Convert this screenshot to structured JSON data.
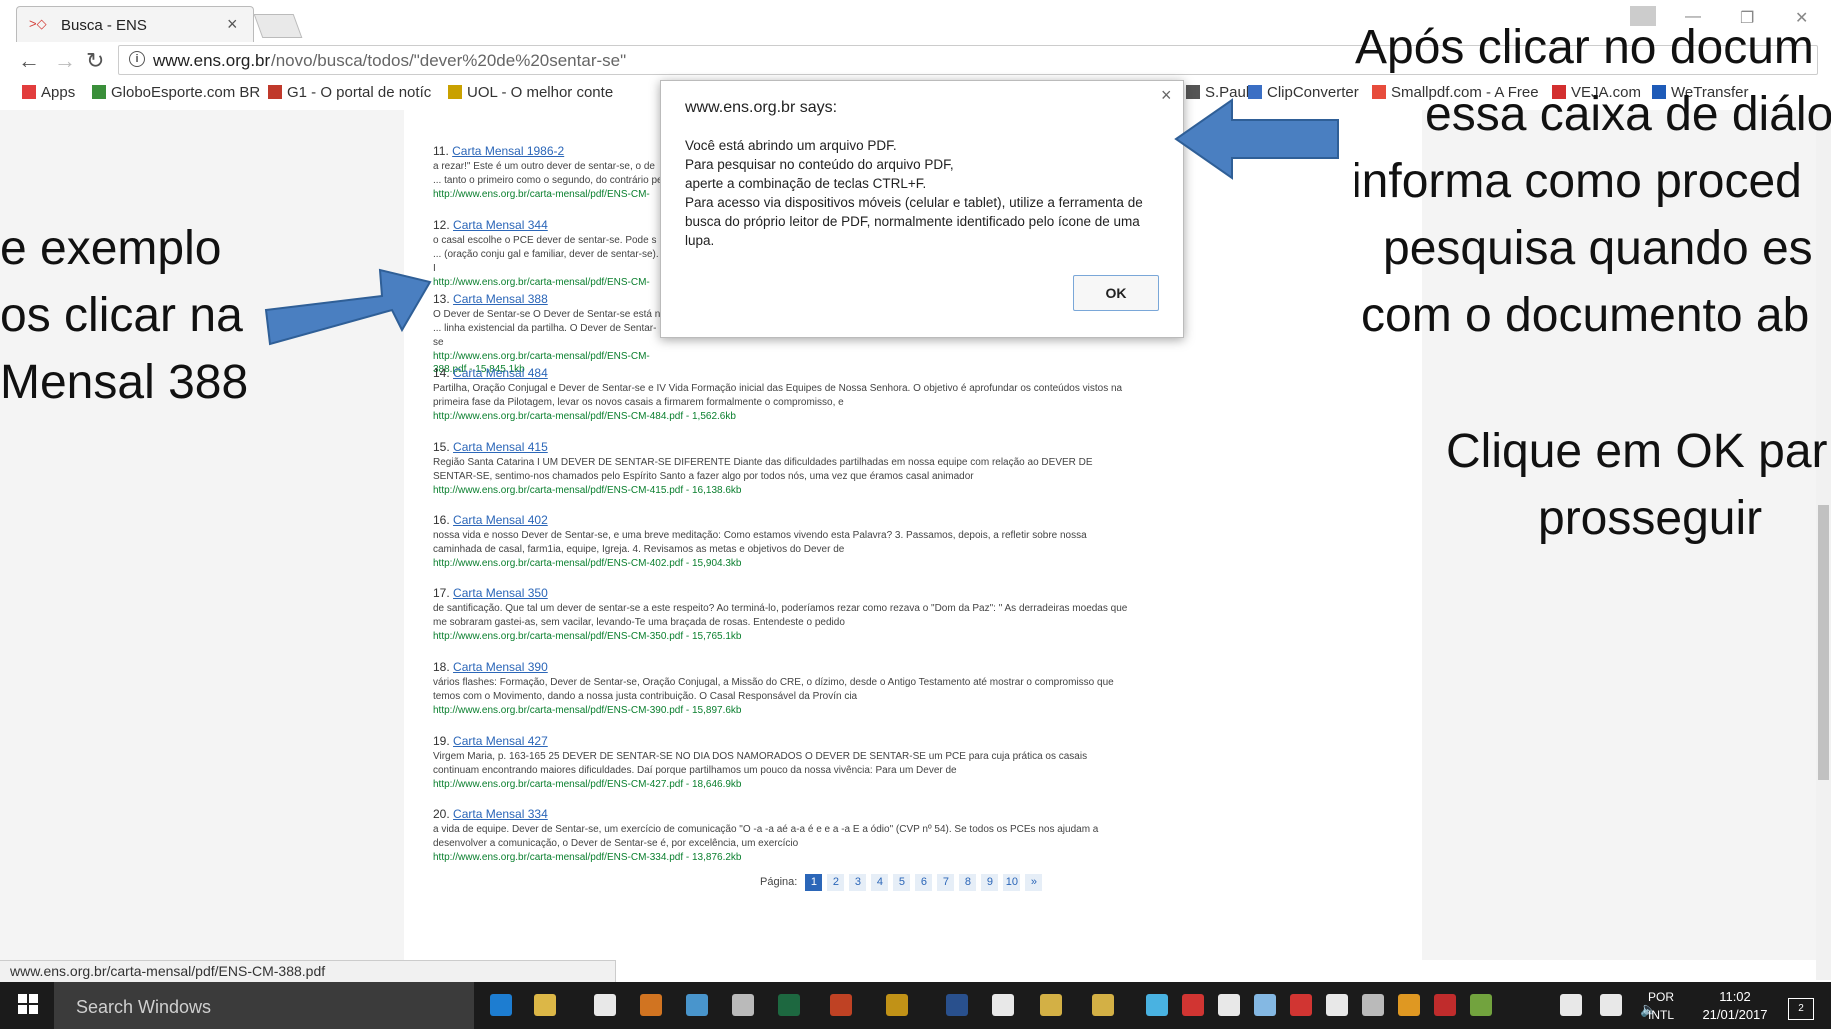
{
  "browser": {
    "tab_title": "Busca - ENS",
    "tab_favicon": "ens-favicon",
    "url_host": "www.ens.org.br",
    "url_path": "/novo/busca/todos/\"dever%20de%20sentar-se\"",
    "bookmarks": [
      {
        "label": "Apps",
        "color": "#e23d3d"
      },
      {
        "label": "GloboEsporte.com BR",
        "color": "#3a8f3a"
      },
      {
        "label": "G1 - O portal de notíc",
        "color": "#c0392b"
      },
      {
        "label": "UOL - O melhor conte",
        "color": "#c9a100"
      },
      {
        "label": "S.Paulo",
        "color": "#555555"
      },
      {
        "label": "ClipConverter",
        "color": "#3b6fc4"
      },
      {
        "label": "Smallpdf.com - A Free",
        "color": "#e74c3c"
      },
      {
        "label": "VEJA.com",
        "color": "#d32f2f"
      },
      {
        "label": "WeTransfer",
        "color": "#1e5bb8"
      }
    ]
  },
  "results": [
    {
      "num": "11.",
      "title": "Carta Mensal 1986-2",
      "snippet": "a rezar!\" Este é um outro dever de sentar-se, o de ... tanto o primeiro como o segundo, do contrário pe",
      "url": "http://www.ens.org.br/carta-mensal/pdf/ENS-CM-"
    },
    {
      "num": "12.",
      "title": "Carta Mensal 344",
      "snippet": "o casal escolhe o PCE dever de sentar-se. Pode s ... (oração conju gal e familiar, dever de sentar-se). I",
      "url": "http://www.ens.org.br/carta-mensal/pdf/ENS-CM-"
    },
    {
      "num": "13.",
      "title": "Carta Mensal 388",
      "snippet": "O Dever de Sentar-se O Dever de Sentar-se está n ... linha existencial da partilha. O Dever de Sentar-se",
      "url": "http://www.ens.org.br/carta-mensal/pdf/ENS-CM-388.pdf - 15,845.1kb"
    },
    {
      "num": "14.",
      "title": "Carta Mensal 484",
      "snippet": "Partilha, Oração Conjugal e Dever de Sentar-se e IV Vida Formação inicial das Equipes de Nossa Senhora. O objetivo é aprofundar os conteúdos vistos na primeira fase da Pilotagem, levar os novos casais a firmarem formalmente o compromisso, e",
      "url": "http://www.ens.org.br/carta-mensal/pdf/ENS-CM-484.pdf - 1,562.6kb"
    },
    {
      "num": "15.",
      "title": "Carta Mensal 415",
      "snippet": "Região Santa Catarina I UM DEVER DE SENTAR-SE DIFERENTE Diante das dificuldades partilhadas em nossa equipe com relação ao DEVER DE SENTAR-SE, sentimo-nos chamados pelo Espírito Santo a fazer algo por todos nós, uma vez que éramos casal animador",
      "url": "http://www.ens.org.br/carta-mensal/pdf/ENS-CM-415.pdf - 16,138.6kb"
    },
    {
      "num": "16.",
      "title": "Carta Mensal 402",
      "snippet": "nossa vida e nosso Dever de Sentar-se, e uma breve meditação: Como estamos vivendo esta Palavra? 3. Passamos, depois, a refletir sobre nossa caminhada de casal, farm1ia, equipe, Igreja. 4. Revisamos as metas e objetivos do Dever de",
      "url": "http://www.ens.org.br/carta-mensal/pdf/ENS-CM-402.pdf - 15,904.3kb"
    },
    {
      "num": "17.",
      "title": "Carta Mensal 350",
      "snippet": "de santificação. Que tal um dever de sentar-se a este respeito? Ao terminá-lo, poderíamos rezar como rezava o \"Dom da Paz\": \" As derradeiras moedas que me sobraram gastei-as, sem vacilar, levando-Te uma braçada de rosas. Entendeste o pedido",
      "url": "http://www.ens.org.br/carta-mensal/pdf/ENS-CM-350.pdf - 15,765.1kb"
    },
    {
      "num": "18.",
      "title": "Carta Mensal 390",
      "snippet": "vários flashes: Formação, Dever de Sentar-se, Oração Conjugal, a Missão do CRE, o dízimo, desde o Antigo Testamento até mostrar o compromisso que temos com o Movimento, dando a nossa justa contribuição. O Casal Responsável da Provín cia",
      "url": "http://www.ens.org.br/carta-mensal/pdf/ENS-CM-390.pdf - 15,897.6kb"
    },
    {
      "num": "19.",
      "title": "Carta Mensal 427",
      "snippet": "Virgem Maria, p. 163-165 25 DEVER DE SENTAR-SE NO DIA DOS NAMORADOS O DEVER DE SENTAR-SE um PCE para cuja prática os casais continuam encontrando maiores dificuldades. Daí porque partilhamos um pouco da nossa vivência: Para um Dever de",
      "url": "http://www.ens.org.br/carta-mensal/pdf/ENS-CM-427.pdf - 18,646.9kb"
    },
    {
      "num": "20.",
      "title": "Carta Mensal 334",
      "snippet": "a vida de equipe. Dever de Sentar-se, um exercício de comunicação \"O -a -a aé a-a é e e a -a E a ódio\" (CVP nº 54). Se todos os PCEs nos ajudam a desenvolver a comunicação, o Dever de Sentar-se é, por excelência, um exercício",
      "url": "http://www.ens.org.br/carta-mensal/pdf/ENS-CM-334.pdf - 13,876.2kb"
    }
  ],
  "pager": {
    "label": "Página:",
    "pages": [
      "1",
      "2",
      "3",
      "4",
      "5",
      "6",
      "7",
      "8",
      "9",
      "10",
      "»"
    ],
    "active": "1"
  },
  "status_url": "www.ens.org.br/carta-mensal/pdf/ENS-CM-388.pdf",
  "dialog": {
    "title": "www.ens.org.br says:",
    "lines": [
      "Você está abrindo um arquivo PDF.",
      "Para pesquisar no conteúdo do arquivo PDF,",
      "aperte a combinação de teclas CTRL+F.",
      "Para acesso via dispositivos móveis (celular e tablet), utilize a ferramenta de busca do próprio leitor de PDF, normalmente identificado pelo ícone de uma lupa."
    ],
    "ok_label": "OK"
  },
  "annotations": {
    "left": [
      "e exemplo",
      "os clicar na",
      "Mensal 388"
    ],
    "right_top": [
      "Após clicar no docum",
      "essa caixa de diálo",
      "informa como proced",
      "pesquisa quando es",
      "com o documento ab"
    ],
    "right_bottom": [
      "Clique em OK par",
      "prosseguir"
    ],
    "arrow_color": "#4a7fc1"
  },
  "taskbar": {
    "search_placeholder": "Search Windows",
    "lang_top": "POR",
    "lang_bottom": "INTL",
    "time": "11:02",
    "date": "21/01/2017",
    "notification_count": "2"
  }
}
